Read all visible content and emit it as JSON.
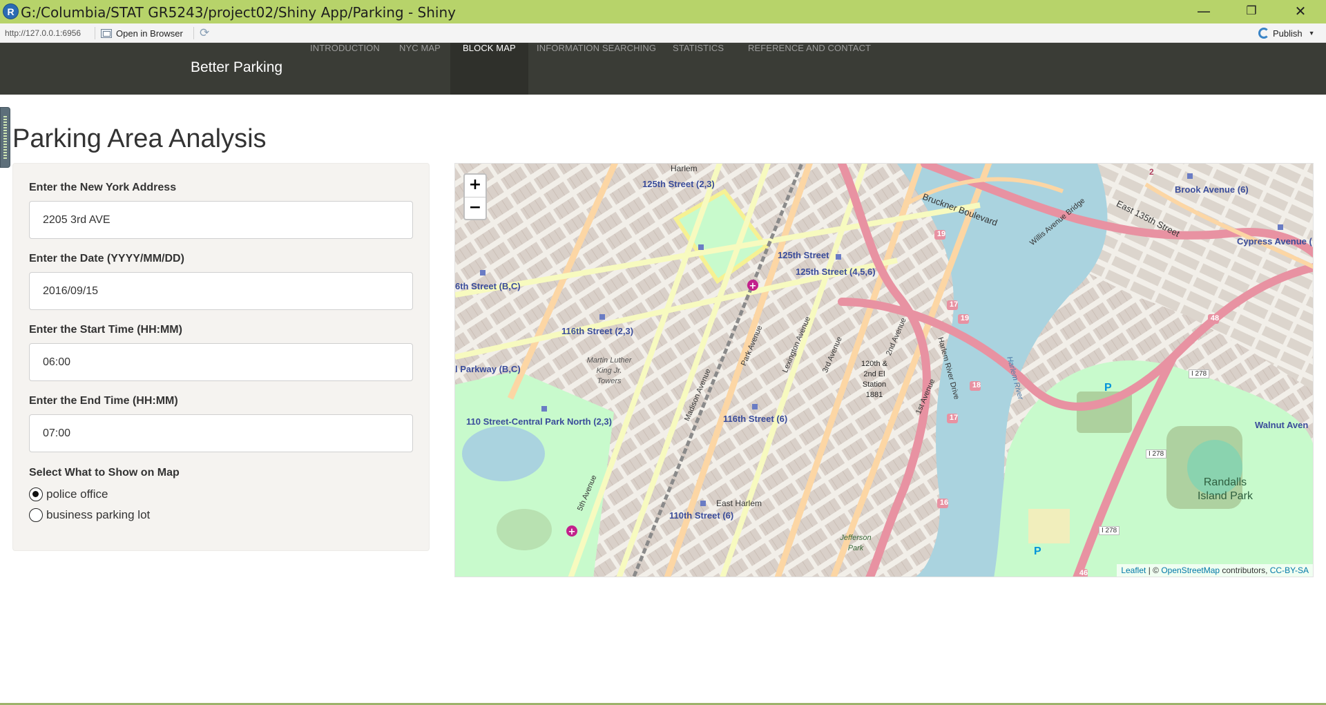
{
  "window": {
    "title": "G:/Columbia/STAT GR5243/project02/Shiny App/Parking - Shiny",
    "app_icon_letter": "R",
    "minimize_glyph": "—",
    "maximize_glyph": "❐",
    "close_glyph": "✕"
  },
  "toolbar": {
    "url": "http://127.0.0.1:6956",
    "open_in_browser_label": "Open in Browser",
    "publish_label": "Publish"
  },
  "navbar": {
    "brand": "Better Parking",
    "items": [
      {
        "label": "INTRODUCTION",
        "active": false
      },
      {
        "label": "NYC MAP",
        "active": false
      },
      {
        "label": "BLOCK MAP",
        "active": true
      },
      {
        "label": "INFORMATION SEARCHING",
        "active": false
      },
      {
        "label": "STATISTICS",
        "active": false
      },
      {
        "label": "REFERENCE AND CONTACT",
        "active": false
      }
    ]
  },
  "page": {
    "title": "Parking Area Analysis"
  },
  "form": {
    "address": {
      "label": "Enter the New York Address",
      "value": "2205 3rd AVE"
    },
    "date": {
      "label": "Enter the Date (YYYY/MM/DD)",
      "value": "2016/09/15"
    },
    "start_time": {
      "label": "Enter the Start Time (HH:MM)",
      "value": "06:00"
    },
    "end_time": {
      "label": "Enter the End Time (HH:MM)",
      "value": "07:00"
    },
    "show_on_map": {
      "label": "Select What to Show on Map",
      "options": [
        {
          "label": "police office",
          "selected": true
        },
        {
          "label": "business parking lot",
          "selected": false
        }
      ]
    }
  },
  "map": {
    "zoom_in": "+",
    "zoom_out": "−",
    "attribution": {
      "leaflet": "Leaflet",
      "sep": " | © ",
      "osm": "OpenStreetMap",
      "contributors": " contributors, ",
      "license": "CC-BY-SA"
    },
    "labels": {
      "harlem": "Harlem",
      "st125_23": "125th Street (2,3)",
      "st125": "125th Street",
      "st125_456": "125th Street (4,5,6)",
      "st116_23": "116th Street (2,3)",
      "st116_6": "116th Street (6)",
      "st110_6": "110th Street (6)",
      "st110_cp": "110 Street-Central Park North (2,3)",
      "st6_bc": "6th Street (B,C)",
      "parkway_bc": "l Parkway (B,C)",
      "mlk_towers": "Martin Luther King Jr. Towers",
      "station_1881": "120th & 2nd El Station 1881",
      "east_harlem": "East Harlem",
      "jefferson_park": "Jefferson Park",
      "randalls": "Randalls Island Park",
      "brook_ave": "Brook Avenue (6)",
      "cypress_ave": "Cypress Avenue (",
      "walnut_ave": "Walnut Aven",
      "bruckner": "Bruckner Boulevard",
      "harlem_river_drive": "Harlem River Drive",
      "harlem_river": "Harlem River",
      "fifth_ave": "5th Avenue",
      "madison_ave": "Madison Avenue",
      "park_ave": "Park Avenue",
      "lexington_ave": "Lexington Avenue",
      "third_ave": "3rd Avenue",
      "second_ave": "2nd Avenue",
      "first_ave": "1st Avenue",
      "i278": "I 278",
      "east_135th": "East 135th Street",
      "willis_ave_bridge": "Willis Avenue Bridge",
      "parking_p": "P",
      "route_19": "19",
      "route_17": "17",
      "route_18": "18",
      "route_16": "16",
      "route_48": "48",
      "route_46": "46",
      "route_2": "2"
    }
  },
  "colors": {
    "navbar_bg": "#3a3c36",
    "titlebar_bg": "#b7d36a",
    "sidebar_bg": "#f5f3f0",
    "link": "#0078a8",
    "police_marker": "#c2218c"
  },
  "icons": {
    "app": "r-logo-icon",
    "open_in_browser": "browser-window-icon",
    "refresh": "refresh-icon",
    "publish": "publish-icon",
    "police_marker": "police-marker-icon"
  }
}
